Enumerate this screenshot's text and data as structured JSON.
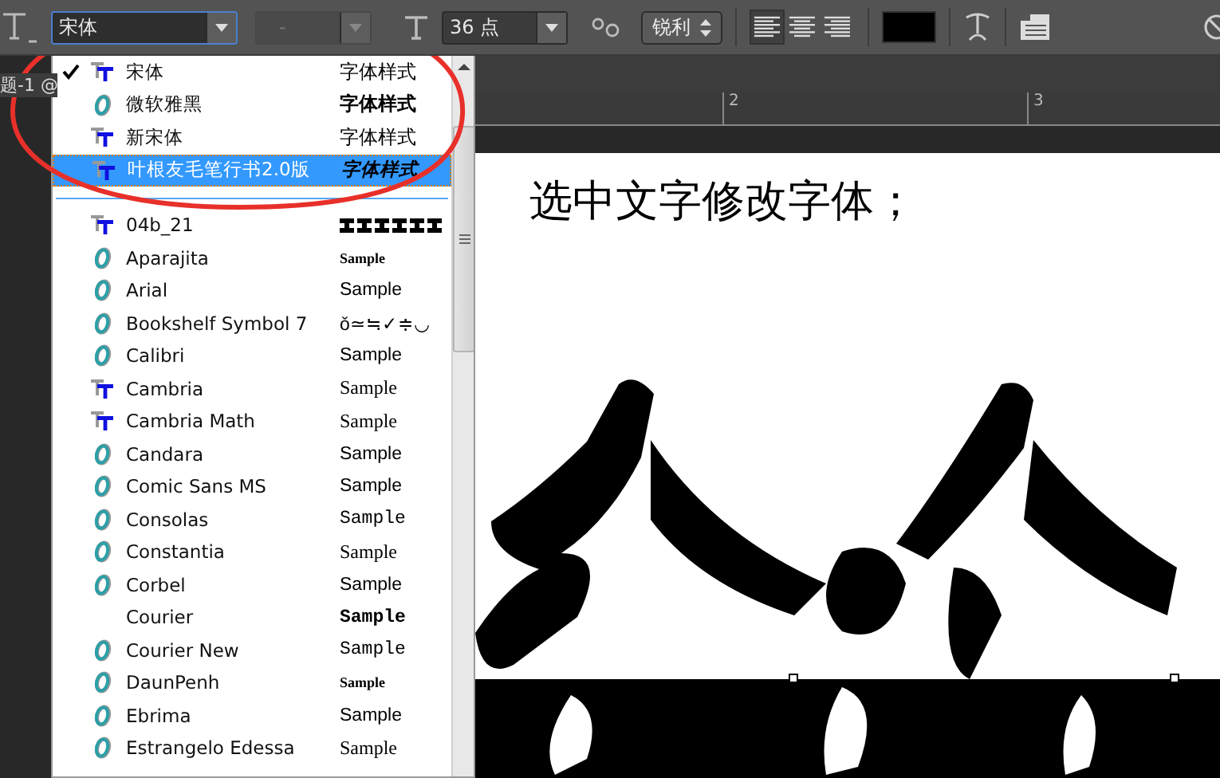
{
  "toolbar": {
    "font_family": {
      "value": "宋体"
    },
    "font_style": {
      "value": "-",
      "disabled": true
    },
    "font_size": {
      "value": "36 点"
    },
    "antialias": {
      "value": "锐利"
    },
    "align": [
      {
        "selected": true
      },
      {
        "selected": false
      },
      {
        "selected": false
      }
    ]
  },
  "document_tab": {
    "title": "题-1 @"
  },
  "ruler": {
    "labels": [
      "2",
      "3"
    ]
  },
  "canvas": {
    "text": "选中文字修改字体；"
  },
  "font_menu": {
    "recent": [
      {
        "name": "宋体",
        "kind": "tt",
        "sample": {
          "kind": "cjk",
          "text": "字体样式"
        },
        "checked": true,
        "selected": false
      },
      {
        "name": "微软雅黑",
        "kind": "ot",
        "sample": {
          "kind": "cjkbold",
          "text": "字体样式"
        },
        "checked": false,
        "selected": false
      },
      {
        "name": "新宋体",
        "kind": "tt",
        "sample": {
          "kind": "cjk",
          "text": "字体样式"
        },
        "checked": false,
        "selected": false
      },
      {
        "name": "叶根友毛笔行书2.0版",
        "kind": "tt",
        "sample": {
          "kind": "brush",
          "text": "字体样式"
        },
        "checked": false,
        "selected": true
      }
    ],
    "fonts": [
      {
        "name": "04b_21",
        "kind": "tt",
        "sample": {
          "kind": "pixel"
        },
        "checked": false,
        "selected": false
      },
      {
        "name": "Aparajita",
        "kind": "ot",
        "sample": {
          "kind": "tiny",
          "text": "Sample"
        },
        "checked": false,
        "selected": false
      },
      {
        "name": "Arial",
        "kind": "ot",
        "sample": {
          "kind": "sans",
          "text": "Sample"
        },
        "checked": false,
        "selected": false
      },
      {
        "name": "Bookshelf Symbol 7",
        "kind": "ot",
        "sample": {
          "kind": "sans",
          "text": "ǒ≃≒✓≑◡"
        },
        "checked": false,
        "selected": false
      },
      {
        "name": "Calibri",
        "kind": "ot",
        "sample": {
          "kind": "sans",
          "text": "Sample"
        },
        "checked": false,
        "selected": false
      },
      {
        "name": "Cambria",
        "kind": "tt",
        "sample": {
          "kind": "serif",
          "text": "Sample"
        },
        "checked": false,
        "selected": false
      },
      {
        "name": "Cambria Math",
        "kind": "tt",
        "sample": {
          "kind": "serif",
          "text": "Sample"
        },
        "checked": false,
        "selected": false
      },
      {
        "name": "Candara",
        "kind": "ot",
        "sample": {
          "kind": "sans",
          "text": "Sample"
        },
        "checked": false,
        "selected": false
      },
      {
        "name": "Comic Sans MS",
        "kind": "ot",
        "sample": {
          "kind": "sans",
          "text": "Sample"
        },
        "checked": false,
        "selected": false
      },
      {
        "name": "Consolas",
        "kind": "ot",
        "sample": {
          "kind": "mono",
          "text": "Sample"
        },
        "checked": false,
        "selected": false
      },
      {
        "name": "Constantia",
        "kind": "ot",
        "sample": {
          "kind": "serif",
          "text": "Sample"
        },
        "checked": false,
        "selected": false
      },
      {
        "name": "Corbel",
        "kind": "ot",
        "sample": {
          "kind": "sans",
          "text": "Sample"
        },
        "checked": false,
        "selected": false
      },
      {
        "name": "Courier",
        "kind": "none",
        "sample": {
          "kind": "monobold",
          "text": "Sample"
        },
        "checked": false,
        "selected": false
      },
      {
        "name": "Courier New",
        "kind": "ot",
        "sample": {
          "kind": "mono",
          "text": "Sample"
        },
        "checked": false,
        "selected": false
      },
      {
        "name": "DaunPenh",
        "kind": "ot",
        "sample": {
          "kind": "tiny",
          "text": "Sample"
        },
        "checked": false,
        "selected": false
      },
      {
        "name": "Ebrima",
        "kind": "ot",
        "sample": {
          "kind": "sans",
          "text": "Sample"
        },
        "checked": false,
        "selected": false
      },
      {
        "name": "Estrangelo Edessa",
        "kind": "ot",
        "sample": {
          "kind": "serif",
          "text": "Sample"
        },
        "checked": false,
        "selected": false
      }
    ]
  }
}
